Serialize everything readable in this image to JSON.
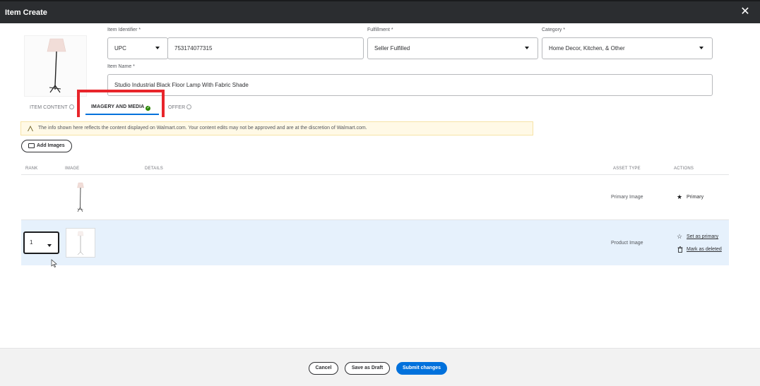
{
  "window": {
    "title": "Item Create",
    "close_symbol": "✕"
  },
  "form": {
    "item_identifier": {
      "label": "Item Identifier *",
      "type_value": "UPC",
      "value": "753174077315"
    },
    "fulfillment": {
      "label": "Fulfillment *",
      "value": "Seller Fulfilled"
    },
    "category": {
      "label": "Category *",
      "value": "Home Decor, Kitchen, & Other"
    },
    "item_name": {
      "label": "Item Name *",
      "value": "Studio Industrial Black Floor Lamp With Fabric Shade"
    }
  },
  "tabs": [
    {
      "label": "ITEM CONTENT",
      "status_icon": "check-circle-outline-icon"
    },
    {
      "label": "IMAGERY AND MEDIA",
      "status_icon": "check-circle-filled-icon",
      "active": true
    },
    {
      "label": "OFFER",
      "status_icon": "check-circle-outline-icon"
    }
  ],
  "notice": "The info shown here reflects the content displayed on Walmart.com. Your content edits may not be approved and are at the discretion of Walmart.com.",
  "add_images_label": "Add Images",
  "table": {
    "headers": {
      "rank": "RANK",
      "image": "IMAGE",
      "details": "DETAILS",
      "asset_type": "ASSET TYPE",
      "actions": "ACTIONS"
    },
    "rows": [
      {
        "rank": "",
        "asset_type": "Primary Image",
        "actions": [
          "Primary"
        ]
      },
      {
        "rank": "1",
        "asset_type": "Product Image",
        "actions": [
          "Set as primary",
          "Mark as deleted"
        ]
      }
    ]
  },
  "footer": {
    "cancel": "Cancel",
    "save_draft": "Save as Draft",
    "submit": "Submit changes"
  },
  "colors": {
    "accent": "#0071dc",
    "highlight_box": "#e8252b",
    "selected_row": "#e6f1fc",
    "success": "#2a8703"
  }
}
